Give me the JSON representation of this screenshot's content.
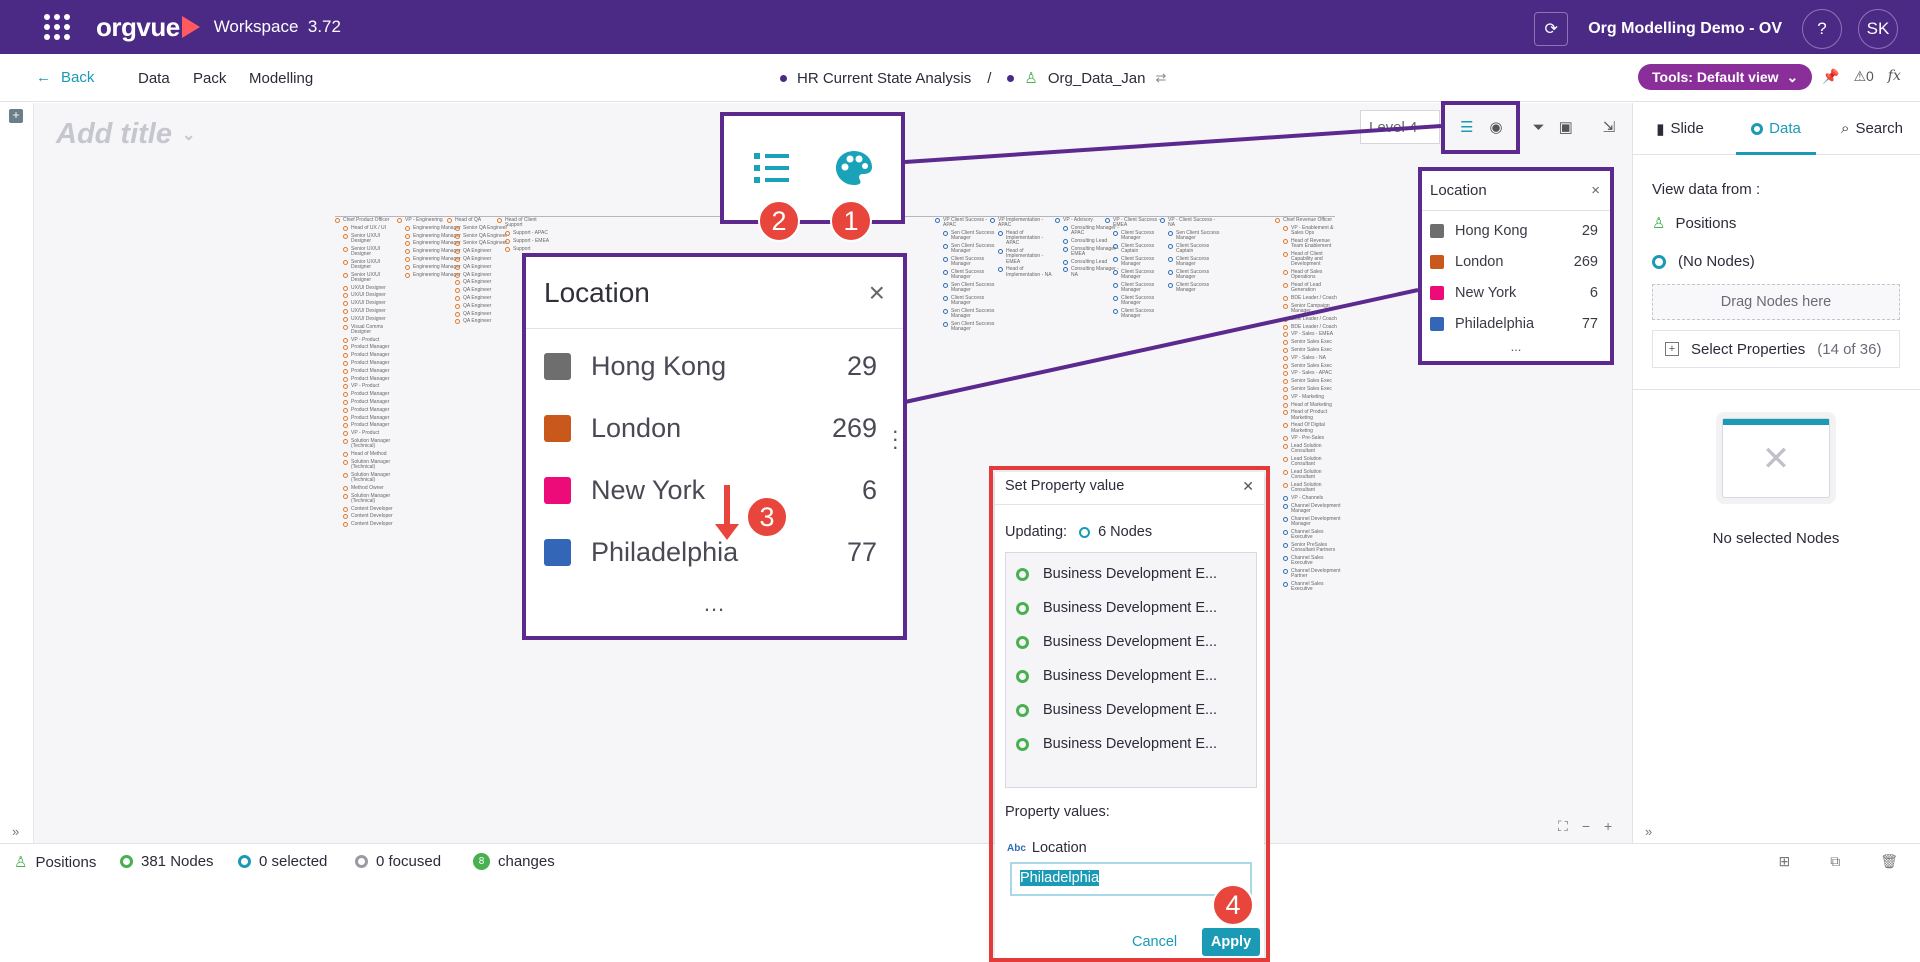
{
  "app": {
    "brand": "orgvue",
    "workspace": "Workspace",
    "version": "3.72",
    "project": "Org Modelling Demo - OV",
    "user_initials": "SK",
    "help_label": "?"
  },
  "nav": {
    "back_label": "Back",
    "links": [
      "Data",
      "Pack",
      "Modelling"
    ],
    "breadcrumb_analysis": "HR Current State Analysis",
    "breadcrumb_sep": "/",
    "breadcrumb_dataset": "Org_Data_Jan",
    "tools_label": "Tools: Default view",
    "alerts_count": "0",
    "fx_label": "fx"
  },
  "canvas": {
    "title_placeholder": "Add title",
    "level_label": "Level 4"
  },
  "org_chart": {
    "columns": [
      {
        "head": "Chief Product Officer",
        "nodes": [
          "Head of UX / UI",
          "Senior UX/UI Designer",
          "Senior UX/UI Designer",
          "Senior UX/UI Designer",
          "Senior UX/UI Designer",
          "UX/UI Designer",
          "UX/UI Designer",
          "UX/UI Designer",
          "UX/UI Designer",
          "UX/UI Designer",
          "Visual Comms Designer",
          "VP - Product",
          "Product Manager",
          "Product Manager",
          "Product Manager",
          "Product Manager",
          "Product Manager",
          "VP - Product",
          "Product Manager",
          "Product Manager",
          "Product Manager",
          "Product Manager",
          "Product Manager",
          "VP - Product",
          "Solution Manager (Technical)",
          "Head of Method",
          "Solution Manager (Technical)",
          "Solution Manager (Technical)",
          "Method Owner",
          "Solution Manager (Technical)",
          "Content Developer",
          "Content Developer",
          "Content Developer"
        ]
      },
      {
        "head": "VP - Engineering",
        "nodes": [
          "Engineering Manager",
          "Engineering Manager",
          "Engineering Manager",
          "Engineering Manager",
          "Engineering Manager",
          "Engineering Manager",
          "Engineering Manager"
        ]
      },
      {
        "head": "Head of QA",
        "nodes": [
          "Senior QA Engineer",
          "Senior QA Engineer",
          "Senior QA Engineer",
          "QA Engineer",
          "QA Engineer",
          "QA Engineer",
          "QA Engineer",
          "QA Engineer",
          "QA Engineer",
          "QA Engineer",
          "QA Engineer",
          "QA Engineer",
          "QA Engineer"
        ]
      },
      {
        "head": "Head of Client Support",
        "nodes": [
          "Support - APAC",
          "Support - EMEA",
          "Support"
        ]
      },
      {
        "head": "VP Client Success - APAC",
        "nodes": [
          "Sen Client Success Manager",
          "Sen Client Success Manager",
          "Client Success Manager",
          "Client Success Manager",
          "Sen Client Success Manager",
          "Client Success Manager",
          "Sen Client Success Manager",
          "Sen Client Success Manager"
        ]
      },
      {
        "head": "VP Implementation - APAC",
        "nodes": [
          "Head of Implementation - APAC",
          "Head of Implementation - EMEA",
          "Head of Implementation - NA"
        ]
      },
      {
        "head": "VP - Advisory",
        "nodes": [
          "Consulting Manager - APAC",
          "Consulting Lead",
          "Consulting Manager - EMEA",
          "Consulting Lead",
          "Consulting Manager - NA"
        ]
      },
      {
        "head": "VP - Client Success - EMEA",
        "nodes": [
          "Client Success Manager",
          "Client Success Captain",
          "Client Success Manager",
          "Client Success Manager",
          "Client Success Manager",
          "Client Success Manager",
          "Client Success Manager"
        ]
      },
      {
        "head": "VP - Client Success - NA",
        "nodes": [
          "Sen Client Success Manager",
          "Client Success Captain",
          "Client Success Manager",
          "Client Success Manager",
          "Client Success Manager"
        ]
      },
      {
        "head": "Chief Revenue Officer",
        "nodes": [
          "VP - Enablement & Sales Ops",
          "Head of Revenue Team Enablement",
          "Head of Client Capability and Development",
          "Head of Sales Operations",
          "Head of Lead Generation",
          "BDE Leader / Coach",
          "Senior Campaign Manager",
          "BDE Leader / Coach",
          "BDE Leader / Coach",
          "VP - Sales - EMEA",
          "Senior Sales Exec",
          "Senior Sales Exec",
          "VP - Sales - NA",
          "Senior Sales Exec",
          "VP - Sales - APAC",
          "Senior Sales Exec",
          "Senior Sales Exec",
          "VP - Marketing",
          "Head of Marketing",
          "Head of Product Marketing",
          "Head Of Digital Marketing",
          "VP - Pre-Sales",
          "Lead Solution Consultant",
          "Lead Solution Consultant",
          "Lead Solution Consultant",
          "Lead Solution Consultant",
          "VP - Channels",
          "Channel Development Manager",
          "Channel Development Manager",
          "Channel Sales Executive",
          "Senior PreSales Consultant Partners",
          "Channel Sales Executive",
          "Channel Development Partner",
          "Channel Sales Executive"
        ]
      }
    ]
  },
  "location_legend": {
    "title": "Location",
    "close": "×",
    "items": [
      {
        "name": "Hong Kong",
        "count": "29",
        "color": "#6e6e6e"
      },
      {
        "name": "London",
        "count": "269",
        "color": "#c8581c"
      },
      {
        "name": "New York",
        "count": "6",
        "color": "#ec0b79"
      },
      {
        "name": "Philadelphia",
        "count": "77",
        "color": "#3366b6"
      }
    ],
    "more": "..."
  },
  "annotations": {
    "badge_1": "1",
    "badge_2": "2",
    "badge_3": "3",
    "badge_4": "4"
  },
  "right_panel": {
    "tabs": [
      "Slide",
      "Data",
      "Search"
    ],
    "view_from_label": "View data from :",
    "positions_label": "Positions",
    "no_nodes_label": "(No Nodes)",
    "drag_label": "Drag Nodes here",
    "select_props_label": "Select Properties",
    "select_props_count": "(14 of 36)",
    "no_selected_label": "No selected Nodes"
  },
  "status_bar": {
    "positions": "Positions",
    "nodes": "381 Nodes",
    "selected": "0 selected",
    "focused": "0 focused",
    "changes_count": "8",
    "changes_label": "changes"
  },
  "dialog": {
    "title": "Set Property value",
    "updating_label": "Updating:",
    "updating_count": "6 Nodes",
    "items": [
      "Business Development E...",
      "Business Development E...",
      "Business Development E...",
      "Business Development E...",
      "Business Development E...",
      "Business Development E..."
    ],
    "property_values_label": "Property values:",
    "field_type": "Abc",
    "field_label": "Location",
    "field_value": "Philadelphia",
    "cancel_label": "Cancel",
    "apply_label": "Apply"
  }
}
